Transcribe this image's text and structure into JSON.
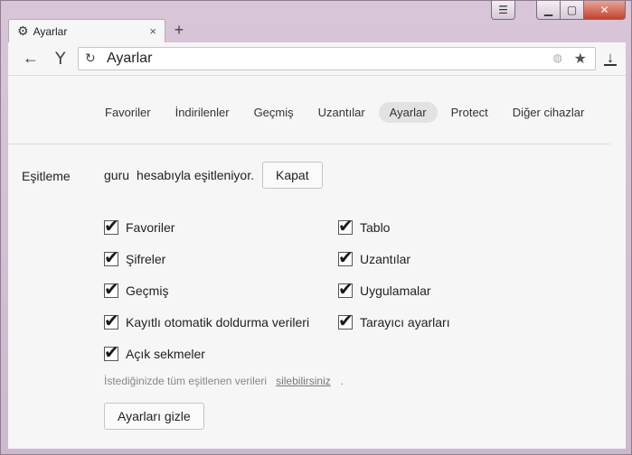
{
  "window": {
    "menu_icon": "☰",
    "minimize_icon": "▁",
    "maximize_icon": "▢",
    "close_icon": "✕"
  },
  "tab": {
    "title": "Ayarlar",
    "close": "×",
    "new_tab": "+"
  },
  "toolbar": {
    "back": "←",
    "logo": "Y",
    "reload": "↻",
    "url": "Ayarlar",
    "globe": "◍",
    "star": "★",
    "download": "↓"
  },
  "nav": {
    "items": [
      "Favoriler",
      "İndirilenler",
      "Geçmiş",
      "Uzantılar",
      "Ayarlar",
      "Protect",
      "Diğer cihazlar"
    ],
    "active": "Ayarlar"
  },
  "sync": {
    "section_title": "Eşitleme",
    "user": "guru",
    "status": "hesabıyla eşitleniyor.",
    "disconnect_button": "Kapat",
    "left_items": [
      {
        "label": "Favoriler",
        "checked": true
      },
      {
        "label": "Şifreler",
        "checked": true
      },
      {
        "label": "Geçmiş",
        "checked": true
      },
      {
        "label": "Kayıtlı otomatik doldurma verileri",
        "checked": true
      },
      {
        "label": "Açık sekmeler",
        "checked": true
      }
    ],
    "right_items": [
      {
        "label": "Tablo",
        "checked": true
      },
      {
        "label": "Uzantılar",
        "checked": true
      },
      {
        "label": "Uygulamalar",
        "checked": true
      },
      {
        "label": "Tarayıcı ayarları",
        "checked": true
      }
    ],
    "note_text": "İstediğinizde tüm eşitlenen verileri",
    "note_link": "silebilirsiniz",
    "note_end": ".",
    "hide_button": "Ayarları gizle"
  }
}
